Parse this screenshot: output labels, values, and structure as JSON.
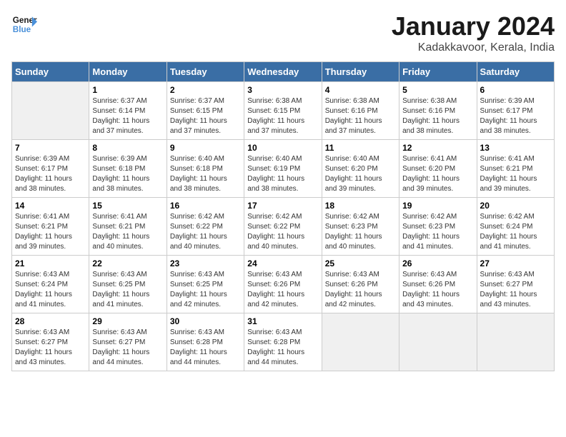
{
  "header": {
    "logo_line1": "General",
    "logo_line2": "Blue",
    "title": "January 2024",
    "subtitle": "Kadakkavoor, Kerala, India"
  },
  "weekdays": [
    "Sunday",
    "Monday",
    "Tuesday",
    "Wednesday",
    "Thursday",
    "Friday",
    "Saturday"
  ],
  "weeks": [
    [
      {
        "day": "",
        "info": ""
      },
      {
        "day": "1",
        "info": "Sunrise: 6:37 AM\nSunset: 6:14 PM\nDaylight: 11 hours\nand 37 minutes."
      },
      {
        "day": "2",
        "info": "Sunrise: 6:37 AM\nSunset: 6:15 PM\nDaylight: 11 hours\nand 37 minutes."
      },
      {
        "day": "3",
        "info": "Sunrise: 6:38 AM\nSunset: 6:15 PM\nDaylight: 11 hours\nand 37 minutes."
      },
      {
        "day": "4",
        "info": "Sunrise: 6:38 AM\nSunset: 6:16 PM\nDaylight: 11 hours\nand 37 minutes."
      },
      {
        "day": "5",
        "info": "Sunrise: 6:38 AM\nSunset: 6:16 PM\nDaylight: 11 hours\nand 38 minutes."
      },
      {
        "day": "6",
        "info": "Sunrise: 6:39 AM\nSunset: 6:17 PM\nDaylight: 11 hours\nand 38 minutes."
      }
    ],
    [
      {
        "day": "7",
        "info": "Sunrise: 6:39 AM\nSunset: 6:17 PM\nDaylight: 11 hours\nand 38 minutes."
      },
      {
        "day": "8",
        "info": "Sunrise: 6:39 AM\nSunset: 6:18 PM\nDaylight: 11 hours\nand 38 minutes."
      },
      {
        "day": "9",
        "info": "Sunrise: 6:40 AM\nSunset: 6:18 PM\nDaylight: 11 hours\nand 38 minutes."
      },
      {
        "day": "10",
        "info": "Sunrise: 6:40 AM\nSunset: 6:19 PM\nDaylight: 11 hours\nand 38 minutes."
      },
      {
        "day": "11",
        "info": "Sunrise: 6:40 AM\nSunset: 6:20 PM\nDaylight: 11 hours\nand 39 minutes."
      },
      {
        "day": "12",
        "info": "Sunrise: 6:41 AM\nSunset: 6:20 PM\nDaylight: 11 hours\nand 39 minutes."
      },
      {
        "day": "13",
        "info": "Sunrise: 6:41 AM\nSunset: 6:21 PM\nDaylight: 11 hours\nand 39 minutes."
      }
    ],
    [
      {
        "day": "14",
        "info": "Sunrise: 6:41 AM\nSunset: 6:21 PM\nDaylight: 11 hours\nand 39 minutes."
      },
      {
        "day": "15",
        "info": "Sunrise: 6:41 AM\nSunset: 6:21 PM\nDaylight: 11 hours\nand 40 minutes."
      },
      {
        "day": "16",
        "info": "Sunrise: 6:42 AM\nSunset: 6:22 PM\nDaylight: 11 hours\nand 40 minutes."
      },
      {
        "day": "17",
        "info": "Sunrise: 6:42 AM\nSunset: 6:22 PM\nDaylight: 11 hours\nand 40 minutes."
      },
      {
        "day": "18",
        "info": "Sunrise: 6:42 AM\nSunset: 6:23 PM\nDaylight: 11 hours\nand 40 minutes."
      },
      {
        "day": "19",
        "info": "Sunrise: 6:42 AM\nSunset: 6:23 PM\nDaylight: 11 hours\nand 41 minutes."
      },
      {
        "day": "20",
        "info": "Sunrise: 6:42 AM\nSunset: 6:24 PM\nDaylight: 11 hours\nand 41 minutes."
      }
    ],
    [
      {
        "day": "21",
        "info": "Sunrise: 6:43 AM\nSunset: 6:24 PM\nDaylight: 11 hours\nand 41 minutes."
      },
      {
        "day": "22",
        "info": "Sunrise: 6:43 AM\nSunset: 6:25 PM\nDaylight: 11 hours\nand 41 minutes."
      },
      {
        "day": "23",
        "info": "Sunrise: 6:43 AM\nSunset: 6:25 PM\nDaylight: 11 hours\nand 42 minutes."
      },
      {
        "day": "24",
        "info": "Sunrise: 6:43 AM\nSunset: 6:26 PM\nDaylight: 11 hours\nand 42 minutes."
      },
      {
        "day": "25",
        "info": "Sunrise: 6:43 AM\nSunset: 6:26 PM\nDaylight: 11 hours\nand 42 minutes."
      },
      {
        "day": "26",
        "info": "Sunrise: 6:43 AM\nSunset: 6:26 PM\nDaylight: 11 hours\nand 43 minutes."
      },
      {
        "day": "27",
        "info": "Sunrise: 6:43 AM\nSunset: 6:27 PM\nDaylight: 11 hours\nand 43 minutes."
      }
    ],
    [
      {
        "day": "28",
        "info": "Sunrise: 6:43 AM\nSunset: 6:27 PM\nDaylight: 11 hours\nand 43 minutes."
      },
      {
        "day": "29",
        "info": "Sunrise: 6:43 AM\nSunset: 6:27 PM\nDaylight: 11 hours\nand 44 minutes."
      },
      {
        "day": "30",
        "info": "Sunrise: 6:43 AM\nSunset: 6:28 PM\nDaylight: 11 hours\nand 44 minutes."
      },
      {
        "day": "31",
        "info": "Sunrise: 6:43 AM\nSunset: 6:28 PM\nDaylight: 11 hours\nand 44 minutes."
      },
      {
        "day": "",
        "info": ""
      },
      {
        "day": "",
        "info": ""
      },
      {
        "day": "",
        "info": ""
      }
    ]
  ]
}
